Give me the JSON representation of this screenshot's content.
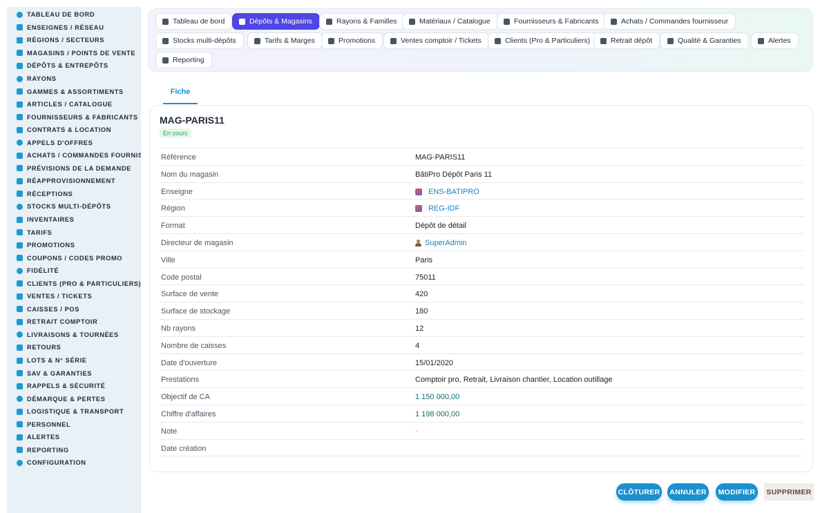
{
  "sidebar": {
    "items": [
      {
        "label": "TABLEAU DE BORD",
        "icon": "dashboard-icon"
      },
      {
        "label": "ENSEIGNES / RÉSEAU",
        "icon": "flag-icon"
      },
      {
        "label": "RÉGIONS / SECTEURS",
        "icon": "map-icon"
      },
      {
        "label": "MAGASINS / POINTS DE VENTE",
        "icon": "store-icon"
      },
      {
        "label": "DÉPÔTS & ENTREPÔTS",
        "icon": "warehouse-icon"
      },
      {
        "label": "RAYONS",
        "icon": "shelf-icon"
      },
      {
        "label": "GAMMES & ASSORTIMENTS",
        "icon": "list-icon"
      },
      {
        "label": "ARTICLES / CATALOGUE",
        "icon": "box-icon"
      },
      {
        "label": "FOURNISSEURS & FABRICANTS",
        "icon": "truck-icon"
      },
      {
        "label": "CONTRATS & LOCATION",
        "icon": "contract-icon"
      },
      {
        "label": "APPELS D'OFFRES",
        "icon": "hammer-icon"
      },
      {
        "label": "ACHATS / COMMANDES FOURNISSEUR",
        "icon": "cart-icon"
      },
      {
        "label": "PRÉVISIONS DE LA DEMANDE",
        "icon": "chart-icon"
      },
      {
        "label": "RÉAPPROVISIONNEMENT",
        "icon": "refresh-icon"
      },
      {
        "label": "RÉCEPTIONS",
        "icon": "inbox-icon"
      },
      {
        "label": "STOCKS MULTI-DÉPÔTS",
        "icon": "stock-icon"
      },
      {
        "label": "INVENTAIRES",
        "icon": "clipboard-icon"
      },
      {
        "label": "TARIFS",
        "icon": "tag-icon"
      },
      {
        "label": "PROMOTIONS",
        "icon": "percent-icon"
      },
      {
        "label": "COUPONS / CODES PROMO",
        "icon": "coupon-icon"
      },
      {
        "label": "FIDÉLITÉ",
        "icon": "card-icon"
      },
      {
        "label": "CLIENTS (PRO & PARTICULIERS)",
        "icon": "user-icon"
      },
      {
        "label": "VENTES / TICKETS",
        "icon": "receipt-icon"
      },
      {
        "label": "CAISSES / POS",
        "icon": "cash-register-icon"
      },
      {
        "label": "RETRAIT COMPTOIR",
        "icon": "car-icon"
      },
      {
        "label": "LIVRAISONS & TOURNÉES",
        "icon": "delivery-icon"
      },
      {
        "label": "RETOURS",
        "icon": "return-icon"
      },
      {
        "label": "LOTS & N° SÉRIE",
        "icon": "barcode-icon"
      },
      {
        "label": "SAV & GARANTIES",
        "icon": "wrench-icon"
      },
      {
        "label": "RAPPELS & SÉCURITÉ",
        "icon": "warning-icon"
      },
      {
        "label": "DÉMARQUE & PERTES",
        "icon": "trash-icon"
      },
      {
        "label": "LOGISTIQUE & TRANSPORT",
        "icon": "forklift-icon"
      },
      {
        "label": "PERSONNEL",
        "icon": "users-icon"
      },
      {
        "label": "ALERTES",
        "icon": "bell-icon"
      },
      {
        "label": "REPORTING",
        "icon": "pie-icon"
      },
      {
        "label": "CONFIGURATION",
        "icon": "gear-icon"
      }
    ]
  },
  "tabs": [
    {
      "label": "Tableau de bord",
      "icon": "dashboard-icon"
    },
    {
      "label": "Dépôts & Magasins",
      "icon": "warehouse-icon",
      "active": true
    },
    {
      "label": "Rayons & Familles",
      "icon": "shelf-icon"
    },
    {
      "label": "Matériaux / Catalogue",
      "icon": "box-icon"
    },
    {
      "label": "Fournisseurs & Fabricants",
      "icon": "truck-icon"
    },
    {
      "label": "Achats / Commandes fournisseur",
      "icon": "cart-icon"
    },
    {
      "label": "Stocks multi-dépôts",
      "icon": "stock-icon"
    },
    {
      "label": "Tarifs & Marges",
      "icon": "tag-icon"
    },
    {
      "label": "Promotions",
      "icon": "percent-icon"
    },
    {
      "label": "Ventes comptoir / Tickets",
      "icon": "receipt-icon"
    },
    {
      "label": "Clients (Pro & Particuliers)",
      "icon": "user-icon"
    },
    {
      "label": "Retrait dépôt",
      "icon": "car-icon"
    },
    {
      "label": "Qualité & Garanties",
      "icon": "check-icon"
    },
    {
      "label": "Alertes",
      "icon": "bell-icon"
    },
    {
      "label": "Reporting",
      "icon": "pie-icon"
    }
  ],
  "subtab": {
    "label": "Fiche"
  },
  "record": {
    "title": "MAG-PARIS11",
    "status": "En cours",
    "fields": [
      {
        "key": "Référence",
        "value": "MAG-PARIS11"
      },
      {
        "key": "Nom du magasin",
        "value": "BâtiPro Dépôt Paris 11"
      },
      {
        "key": "Enseigne",
        "value": "ENS-BATIPRO",
        "kind": "link-chip"
      },
      {
        "key": "Région",
        "value": "REG-IDF",
        "kind": "link-chip"
      },
      {
        "key": "Format",
        "value": "Dépôt de détail"
      },
      {
        "key": "Directeur de magasin",
        "value": "SuperAdmin",
        "kind": "link-user"
      },
      {
        "key": "Ville",
        "value": "Paris"
      },
      {
        "key": "Code postal",
        "value": "75011"
      },
      {
        "key": "Surface de vente",
        "value": "420"
      },
      {
        "key": "Surface de stockage",
        "value": "180"
      },
      {
        "key": "Nb rayons",
        "value": "12"
      },
      {
        "key": "Nombre de caisses",
        "value": "4"
      },
      {
        "key": "Date d'ouverture",
        "value": "15/01/2020"
      },
      {
        "key": "Prestations",
        "value": "Comptoir pro, Retrait, Livraison chantier, Location outillage"
      },
      {
        "key": "Objectif de CA",
        "value": "1 150 000,00",
        "kind": "money"
      },
      {
        "key": "Chiffre d'affaires",
        "value": "1 198 000,00",
        "kind": "money"
      },
      {
        "key": "Note",
        "value": "-",
        "kind": "muted"
      },
      {
        "key": "Date création",
        "value": ""
      }
    ]
  },
  "actions": {
    "close_label": "CLÔTURER",
    "cancel_label": "ANNULER",
    "edit_label": "MODIFIER",
    "delete_label": "SUPPRIMER"
  },
  "colors": {
    "accent": "#4f46e5",
    "primary_button": "#1b8fd0",
    "link": "#1b7fc4",
    "status_badge": "#2a9d55"
  }
}
